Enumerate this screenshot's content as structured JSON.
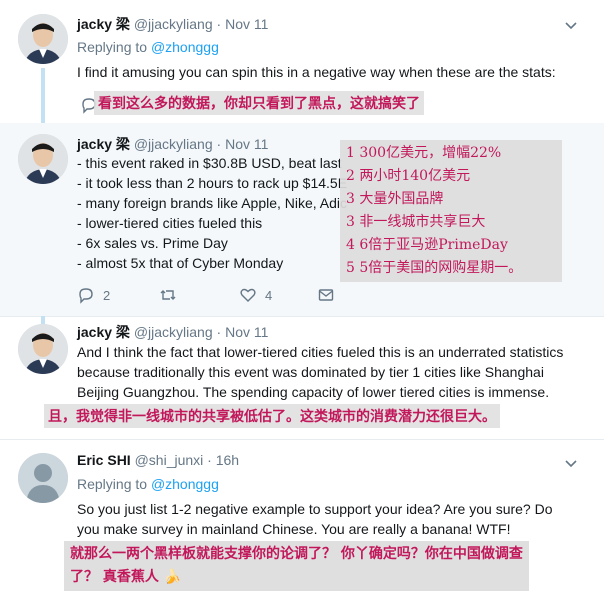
{
  "tweets": [
    {
      "name": "jacky 梁",
      "handle": "@jjackyliang",
      "dot": "·",
      "time": "Nov 11",
      "replying_prefix": "Replying to ",
      "replying_mention": "@zhonggg",
      "lines": [
        "I find it amusing you can spin this in a negative way when these are the stats:"
      ],
      "overlay": "看到这么多的数据，你却只看到了黑点，这就搞笑了"
    },
    {
      "name": "jacky 梁",
      "handle": "@jjackyliang",
      "dot": "·",
      "time": "Nov 11",
      "lines": [
        "- this event raked in $30.8B USD, beat last",
        "- it took less than 2 hours to rack up $14.5E",
        "- many foreign brands like Apple, Nike, Adic",
        "- lower-tiered cities fueled this",
        "- 6x sales vs. Prime Day",
        "- almost 5x that of Cyber Monday"
      ],
      "overlay_lines": [
        "1 300亿美元，增幅22%",
        "2 两小时140亿美元",
        "3 大量外国品牌",
        "3 非一线城市共享巨大",
        "4 6倍于亚马逊PrimeDay",
        "5 5倍于美国的网购星期一。"
      ],
      "actions": {
        "reply_count": "2",
        "retweet_count": "",
        "like_count": "4"
      }
    },
    {
      "name": "jacky 梁",
      "handle": "@jjackyliang",
      "dot": "·",
      "time": "Nov 11",
      "lines": [
        "And I think the fact that lower-tiered cities fueled this is an underrated statistics",
        "because traditionally this event was dominated by tier 1 cities like Shanghai",
        "Beijing Guangzhou. The spending capacity of lower tiered cities is immense."
      ],
      "overlay": "且，我觉得非一线城市的共享被低估了。这类城市的消费潜力还很巨大。"
    },
    {
      "name": "Eric SHI",
      "handle": "@shi_junxi",
      "dot": "·",
      "time": "16h",
      "replying_prefix": "Replying to ",
      "replying_mention": "@zhonggg",
      "lines": [
        "So you just list 1-2 negative example to support your idea? Are you sure? Do",
        "you make survey in mainland Chinese. You are really a banana! WTF!"
      ],
      "overlay_lines": [
        "就那么一两个黑样板就能支撑你的论调了？ 你丫确定吗？你在中国做调查",
        "了？ 真香蕉人 🍌"
      ]
    }
  ]
}
